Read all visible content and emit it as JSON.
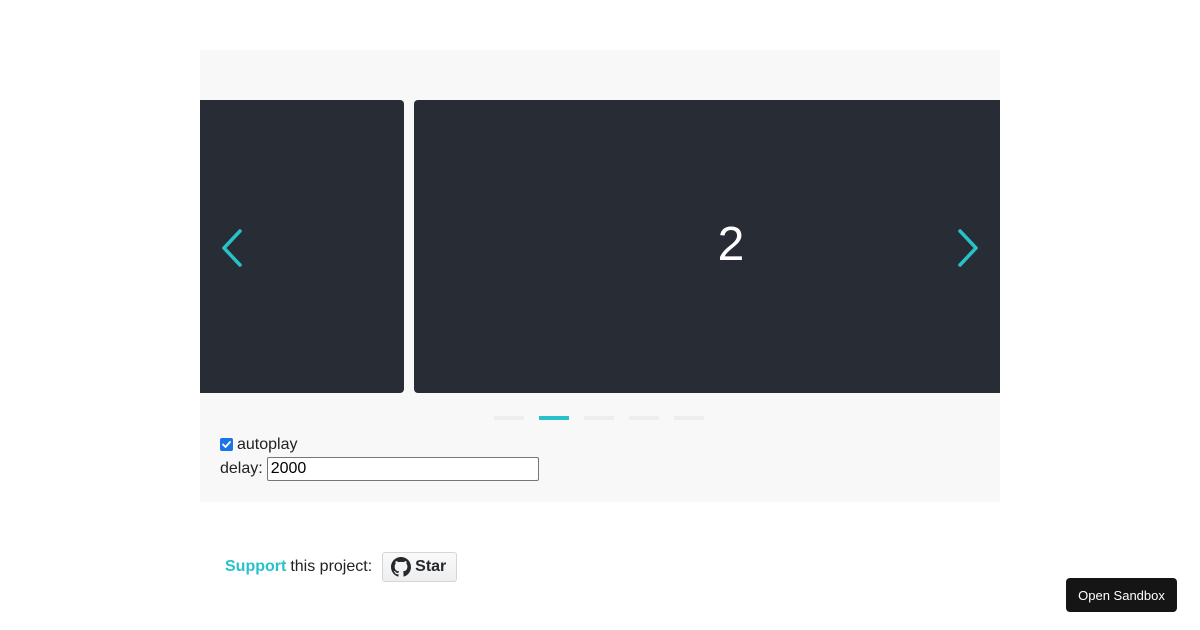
{
  "carousel": {
    "current_slide": "2",
    "prev_arrow_icon": "chevron-left-icon",
    "next_arrow_icon": "chevron-right-icon",
    "accent_color": "#28c1c9",
    "slide_color": "#282c34",
    "dots": [
      {
        "active": false
      },
      {
        "active": true
      },
      {
        "active": false
      },
      {
        "active": false
      },
      {
        "active": false
      }
    ]
  },
  "controls": {
    "autoplay_label": "autoplay",
    "autoplay_checked": true,
    "delay_label": "delay:",
    "delay_value": "2000"
  },
  "support": {
    "link_text": "Support",
    "text": "this project:",
    "star_label": "Star",
    "star_icon": "github-icon"
  },
  "sandbox": {
    "label": "Open Sandbox"
  }
}
